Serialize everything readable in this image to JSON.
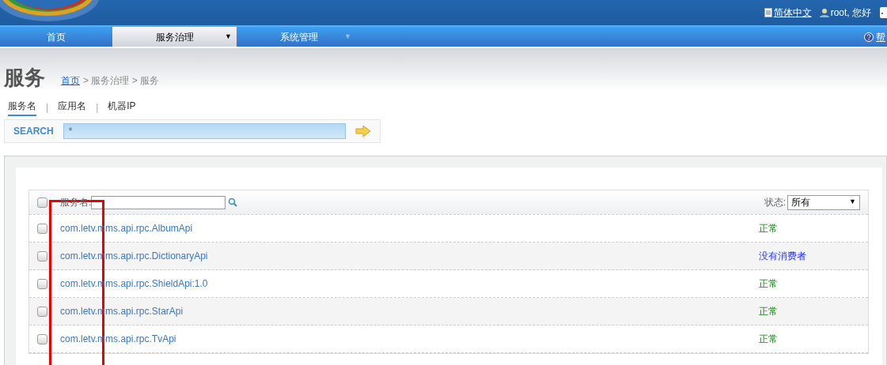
{
  "header": {
    "language": "简体中文",
    "greeting": "root, 您好"
  },
  "nav": {
    "items": [
      {
        "label": "首页",
        "selected": false
      },
      {
        "label": "服务治理",
        "selected": true,
        "caret": "▼"
      },
      {
        "label": "系统管理",
        "selected": false,
        "caret": "▼"
      }
    ],
    "help": "帮"
  },
  "page": {
    "title": "服务",
    "breadcrumb": [
      {
        "label": "首页",
        "link": true
      },
      {
        "label": "> 服务治理 > 服务",
        "link": false
      }
    ]
  },
  "tabs": {
    "separator": "|",
    "items": [
      {
        "label": "服务名",
        "selected": true
      },
      {
        "label": "应用名",
        "selected": false
      },
      {
        "label": "机器IP",
        "selected": false
      }
    ]
  },
  "search": {
    "label": "SEARCH",
    "value": "*"
  },
  "table": {
    "filter_label": "服务名:",
    "status_label": "状态:",
    "status_value": "所有",
    "status_caret": "▼",
    "all_checked": false,
    "rows": [
      {
        "service": "com.letv.mms.api.rpc.AlbumApi",
        "status": "正常",
        "kind": "normal",
        "checked": false
      },
      {
        "service": "com.letv.mms.api.rpc.DictionaryApi",
        "status": "没有消费者",
        "kind": "no-consumer",
        "checked": false
      },
      {
        "service": "com.letv.mms.api.rpc.ShieldApi:1.0",
        "status": "正常",
        "kind": "normal",
        "checked": false
      },
      {
        "service": "com.letv.mms.api.rpc.StarApi",
        "status": "正常",
        "kind": "normal",
        "checked": false
      },
      {
        "service": "com.letv.mms.api.rpc.TvApi",
        "status": "正常",
        "kind": "normal",
        "checked": false
      }
    ]
  }
}
